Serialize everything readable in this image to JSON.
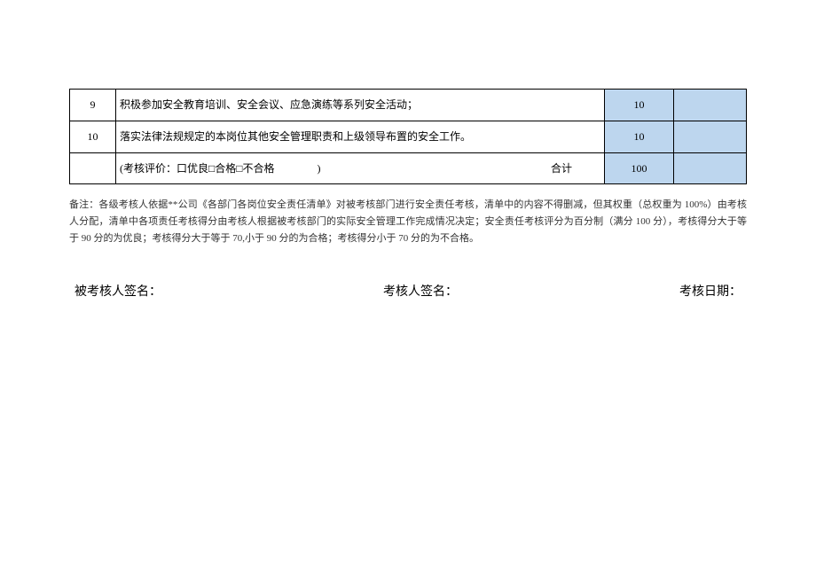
{
  "table": {
    "rows": [
      {
        "num": "9",
        "desc": "积极参加安全教育培训、安全会议、应急演练等系列安全活动；",
        "score": "10",
        "last": ""
      },
      {
        "num": "10",
        "desc": "落实法律法规规定的本岗位其他安全管理职责和上级领导布置的安全工作。",
        "score": "10",
        "last": ""
      }
    ],
    "summary": {
      "num": "",
      "eval_label": "(考核评价：口优良□合格□不合格",
      "eval_close": ")",
      "heji_label": "合计",
      "score": "100",
      "last": ""
    }
  },
  "note": "备注：各级考核人依据**公司《各部门各岗位安全责任清单》对被考核部门进行安全责任考核，清单中的内容不得删减，但其权重（总权重为 100%）由考核人分配，清单中各项责任考核得分由考核人根据被考核部门的实际安全管理工作完成情况决定；安全责任考核评分为百分制（满分 100 分），考核得分大于等于 90 分的为优良；考核得分大于等于 70,小于 90 分的为合格；考核得分小于 70 分的为不合格。",
  "signatures": {
    "examinee": "被考核人签名：",
    "examiner": "考核人签名：",
    "date": "考核日期："
  }
}
